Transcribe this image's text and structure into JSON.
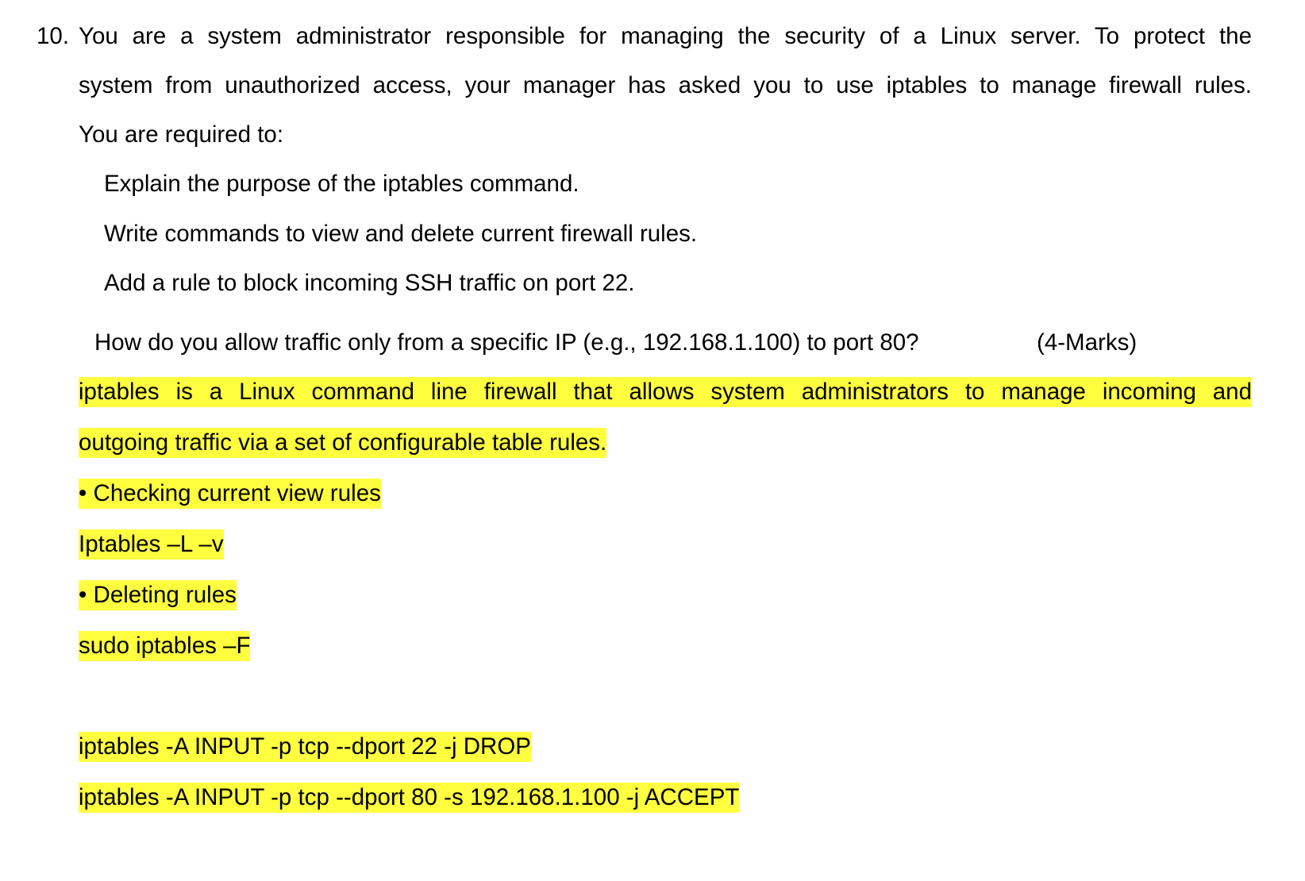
{
  "question": {
    "number": "10.",
    "lines": [
      "You are a system administrator responsible for managing the security of a Linux server. To protect the",
      "system from unauthorized access, your manager has asked you to use iptables to manage firewall rules.",
      "You are required to:"
    ],
    "tasks": [
      "Explain the purpose of the iptables command.",
      "Write commands to view and delete current firewall rules.",
      "Add a rule to block incoming SSH traffic on port 22."
    ],
    "last_task": "How do you allow traffic only from a specific IP (e.g., 192.168.1.100) to port 80?",
    "marks": "(4-Marks)"
  },
  "answer": {
    "definition_line1": "iptables is a Linux command line firewall that allows system administrators to manage incoming and",
    "definition_line2": "outgoing traffic via a set of configurable table rules.",
    "view_heading": "• Checking current view rules",
    "view_command": "Iptables –L –v",
    "delete_heading": "• Deleting rules",
    "delete_command": "sudo iptables –F",
    "block_ssh_command": "iptables -A INPUT -p tcp --dport 22 -j DROP",
    "allow_ip_command": "iptables -A INPUT -p tcp --dport 80 -s 192.168.1.100 -j ACCEPT"
  },
  "colors": {
    "highlight": "#ffff3f"
  }
}
